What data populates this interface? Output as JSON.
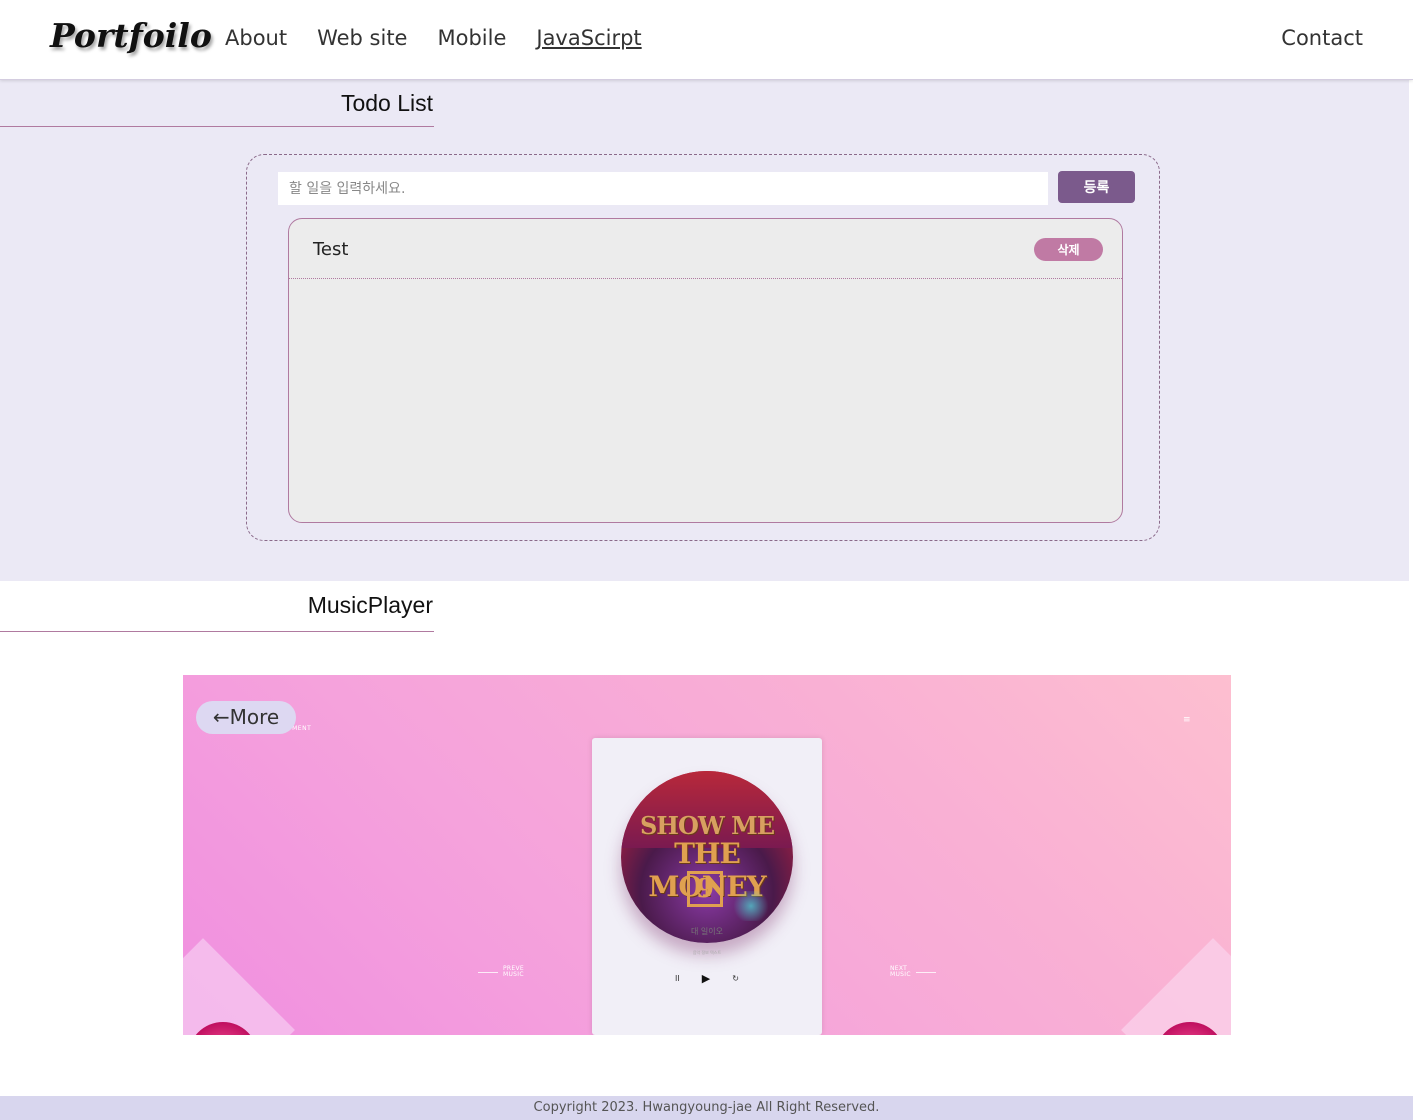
{
  "header": {
    "logo": "Portfoilo",
    "nav": [
      {
        "label": "About"
      },
      {
        "label": "Web site"
      },
      {
        "label": "Mobile"
      },
      {
        "label": "JavaScirpt"
      }
    ],
    "contact": "Contact"
  },
  "todo": {
    "section_title": "Todo List",
    "input_placeholder": "할 일을 입력하세요.",
    "add_label": "등록",
    "items": [
      {
        "text": "Test",
        "delete_label": "삭제"
      }
    ]
  },
  "music": {
    "section_title": "MusicPlayer",
    "more_label": "←More",
    "corner_label": "PMENT",
    "menu_glyph": "≡",
    "album_line1": "SHOW ME",
    "album_line2": "THE MONEY",
    "album_number": "9",
    "song_title": "대 일이오",
    "song_sub": "음악 정보 텍스트",
    "controls": {
      "pause": "II",
      "play": "▶",
      "repeat": "↻"
    },
    "prev_label_1": "PREVE",
    "prev_label_2": "MUSIC",
    "next_label_1": "NEXT",
    "next_label_2": "MUSIC"
  },
  "footer": {
    "copyright": "Copyright 2023. Hwangyoung-jae   All Right Reserved."
  },
  "colors": {
    "accent": "#7b5a8c",
    "delete": "#c07aa4",
    "section_bg": "#ebe9f5",
    "footer_bg": "#d8d6ee"
  }
}
